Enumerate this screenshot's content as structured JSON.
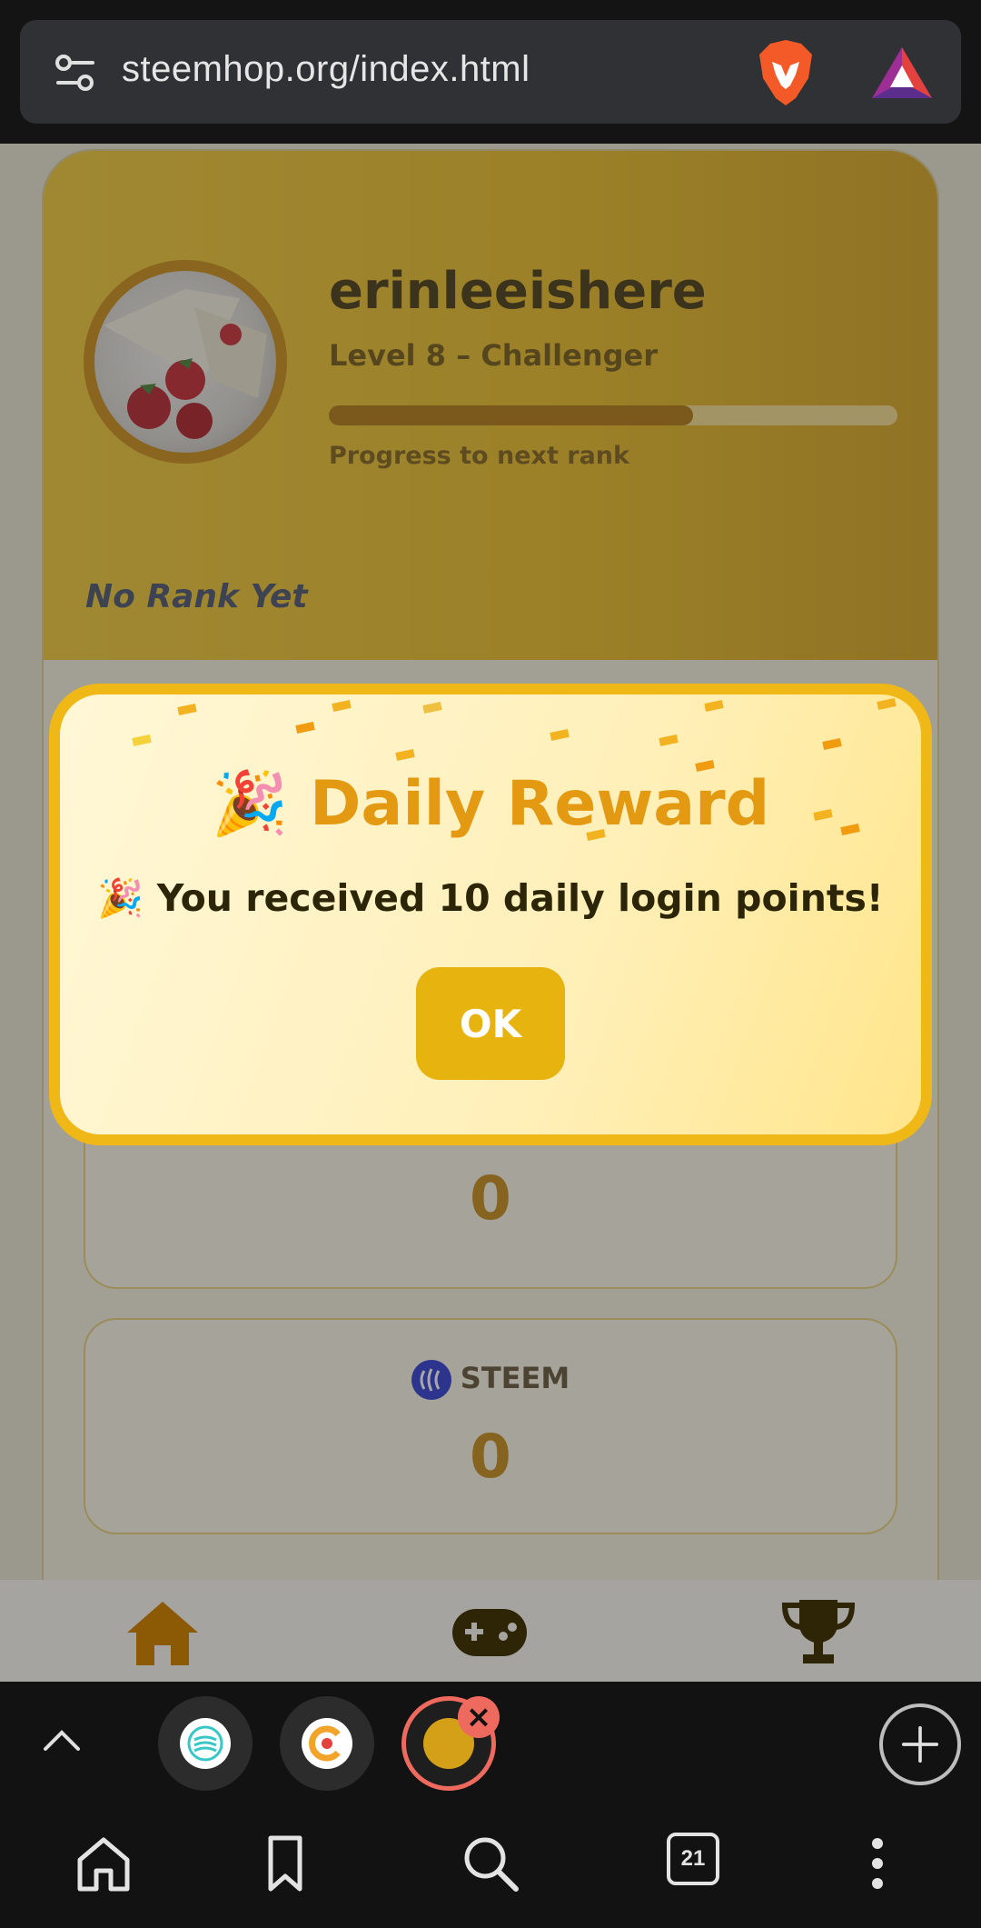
{
  "browser": {
    "url": "steemhop.org/index.html",
    "tab_count": "21",
    "icons": [
      "tune-icon",
      "brave-lion-icon",
      "bat-rewards-icon",
      "chevron-up-icon",
      "plus-icon",
      "home-icon",
      "bookmark-icon",
      "search-icon",
      "kebab-menu-icon"
    ]
  },
  "profile": {
    "username": "erinleeishere",
    "level": "Level 8 – Challenger",
    "progress_label": "Progress to next rank",
    "progress_fraction": 0.64,
    "rank": "No Rank Yet"
  },
  "stats": [
    {
      "label": "",
      "value": "0"
    },
    {
      "label": "STEEM",
      "value": "0"
    }
  ],
  "modal": {
    "title": "🎉 Daily Reward",
    "message": "🎉 You received 10 daily login points!",
    "ok_label": "OK"
  },
  "site_nav": [
    "home-icon",
    "gamepad-icon",
    "trophy-icon"
  ],
  "colors": {
    "accent": "#e7b30f",
    "title_orange": "#e39a12",
    "progress": "#b06f00",
    "tab_active": "#ef6a5e"
  }
}
